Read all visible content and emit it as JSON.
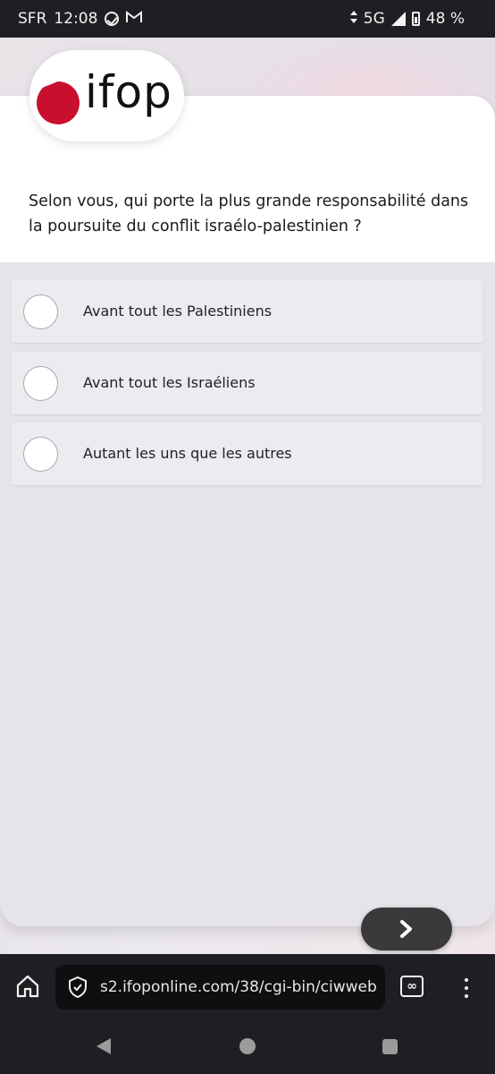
{
  "status_bar": {
    "carrier": "SFR",
    "time": "12:08",
    "network": "5G",
    "battery": "48 %",
    "icons": [
      "check-circle-icon",
      "gmail-icon",
      "data-arrows-icon",
      "signal-icon",
      "battery-icon"
    ]
  },
  "brand": {
    "name": "ifop",
    "accent_color": "#c8102e"
  },
  "question": {
    "text": "Selon vous, qui porte la plus grande responsabilité dans la poursuite du conflit israélo-palestinien ?"
  },
  "options": [
    {
      "label": "Avant tout les Palestiniens",
      "selected": false
    },
    {
      "label": "Avant tout les Israéliens",
      "selected": false
    },
    {
      "label": "Autant les uns que les autres",
      "selected": false
    }
  ],
  "next_button": {
    "icon": "chevron-right-icon"
  },
  "browser": {
    "url": "s2.ifoponline.com/38/cgi-bin/ciwweb",
    "tabs_symbol": "∞"
  },
  "nav": {
    "icons": [
      "back-icon",
      "home-icon",
      "recent-apps-icon"
    ]
  }
}
